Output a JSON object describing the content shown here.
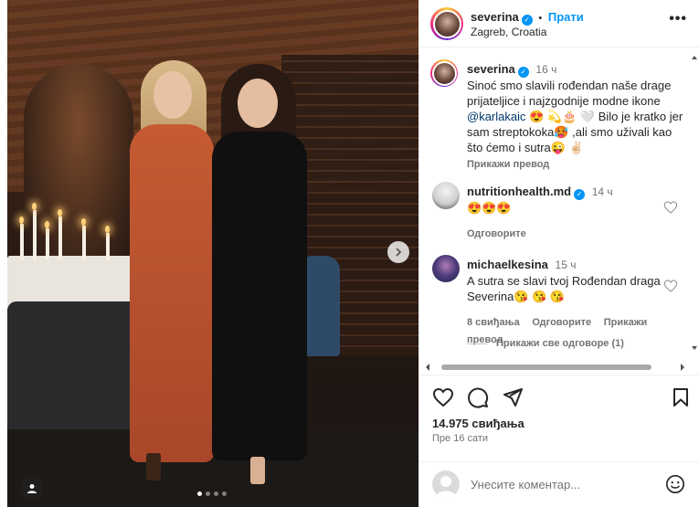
{
  "header": {
    "username": "severina",
    "separator": "•",
    "follow_label": "Прати",
    "location": "Zagreb, Croatia",
    "more_label": "•••"
  },
  "caption": {
    "username": "severina",
    "time": "16 ч",
    "text_start": "Sinoć smo slavili rođendan naše drage prijateljice i najzgodnije modne ikone ",
    "mention": "@karlakaic",
    "emojis_1": " 😍 💫🎂 🤍 ",
    "text_mid": "Bilo je kratko jer sam streptokoka",
    "emojis_2": "🥵",
    "text_end": " ,ali smo uživali kao što ćemo i sutra",
    "emojis_3": "😜 ✌🏻",
    "translate_label": "Прикажи превод"
  },
  "comments": [
    {
      "username": "nutritionhealth.md",
      "verified": true,
      "time": "14 ч",
      "text": "😍😍😍",
      "reply_label": "Одговорите"
    },
    {
      "username": "michaelkesina",
      "verified": false,
      "time": "15 ч",
      "text": "A sutra se slavi tvoj Rođendan draga Severina😘 😘 😘",
      "likes_label": "8 свиђања",
      "reply_label": "Одговорите",
      "translate_label": "Прикажи превод",
      "view_replies_label": "Прикажи све одговоре (1)"
    }
  ],
  "post": {
    "likes": "14.975 свиђања",
    "time_ago": "Пре 16 сати"
  },
  "composer": {
    "placeholder": "Унесите коментар..."
  },
  "carousel": {
    "slide_count": 4,
    "active_index": 0
  },
  "colors": {
    "accent": "#0095f6",
    "mention": "#00376b",
    "secondary_text": "#737373"
  }
}
